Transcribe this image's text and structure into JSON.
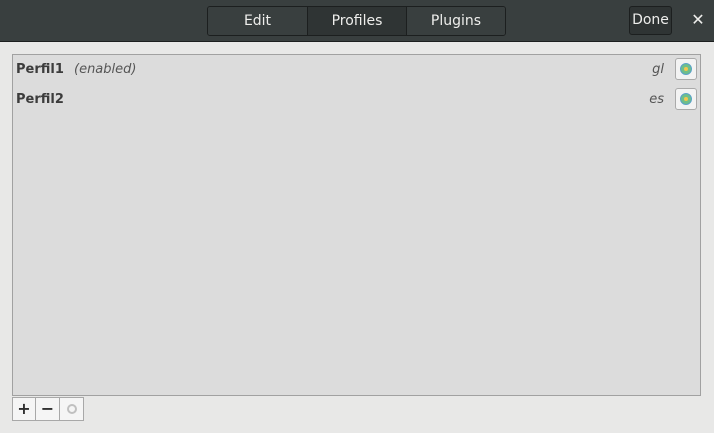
{
  "header": {
    "tabs": [
      {
        "label": "Edit",
        "active": false
      },
      {
        "label": "Profiles",
        "active": true
      },
      {
        "label": "Plugins",
        "active": false
      }
    ],
    "done_label": "Done",
    "close_glyph": "✕"
  },
  "profiles": [
    {
      "name": "Perfil1",
      "status": "(enabled)",
      "language": "gl",
      "icon": "profile-status-icon"
    },
    {
      "name": "Perfil2",
      "status": "",
      "language": "es",
      "icon": "profile-status-icon"
    }
  ],
  "toolbar": {
    "add_glyph": "+",
    "remove_glyph": "−",
    "configure_icon": "configure-icon",
    "configure_disabled": true
  },
  "colors": {
    "header_bg": "#393f3f",
    "window_bg": "#e8e8e7",
    "list_bg": "#dcdcdc"
  }
}
